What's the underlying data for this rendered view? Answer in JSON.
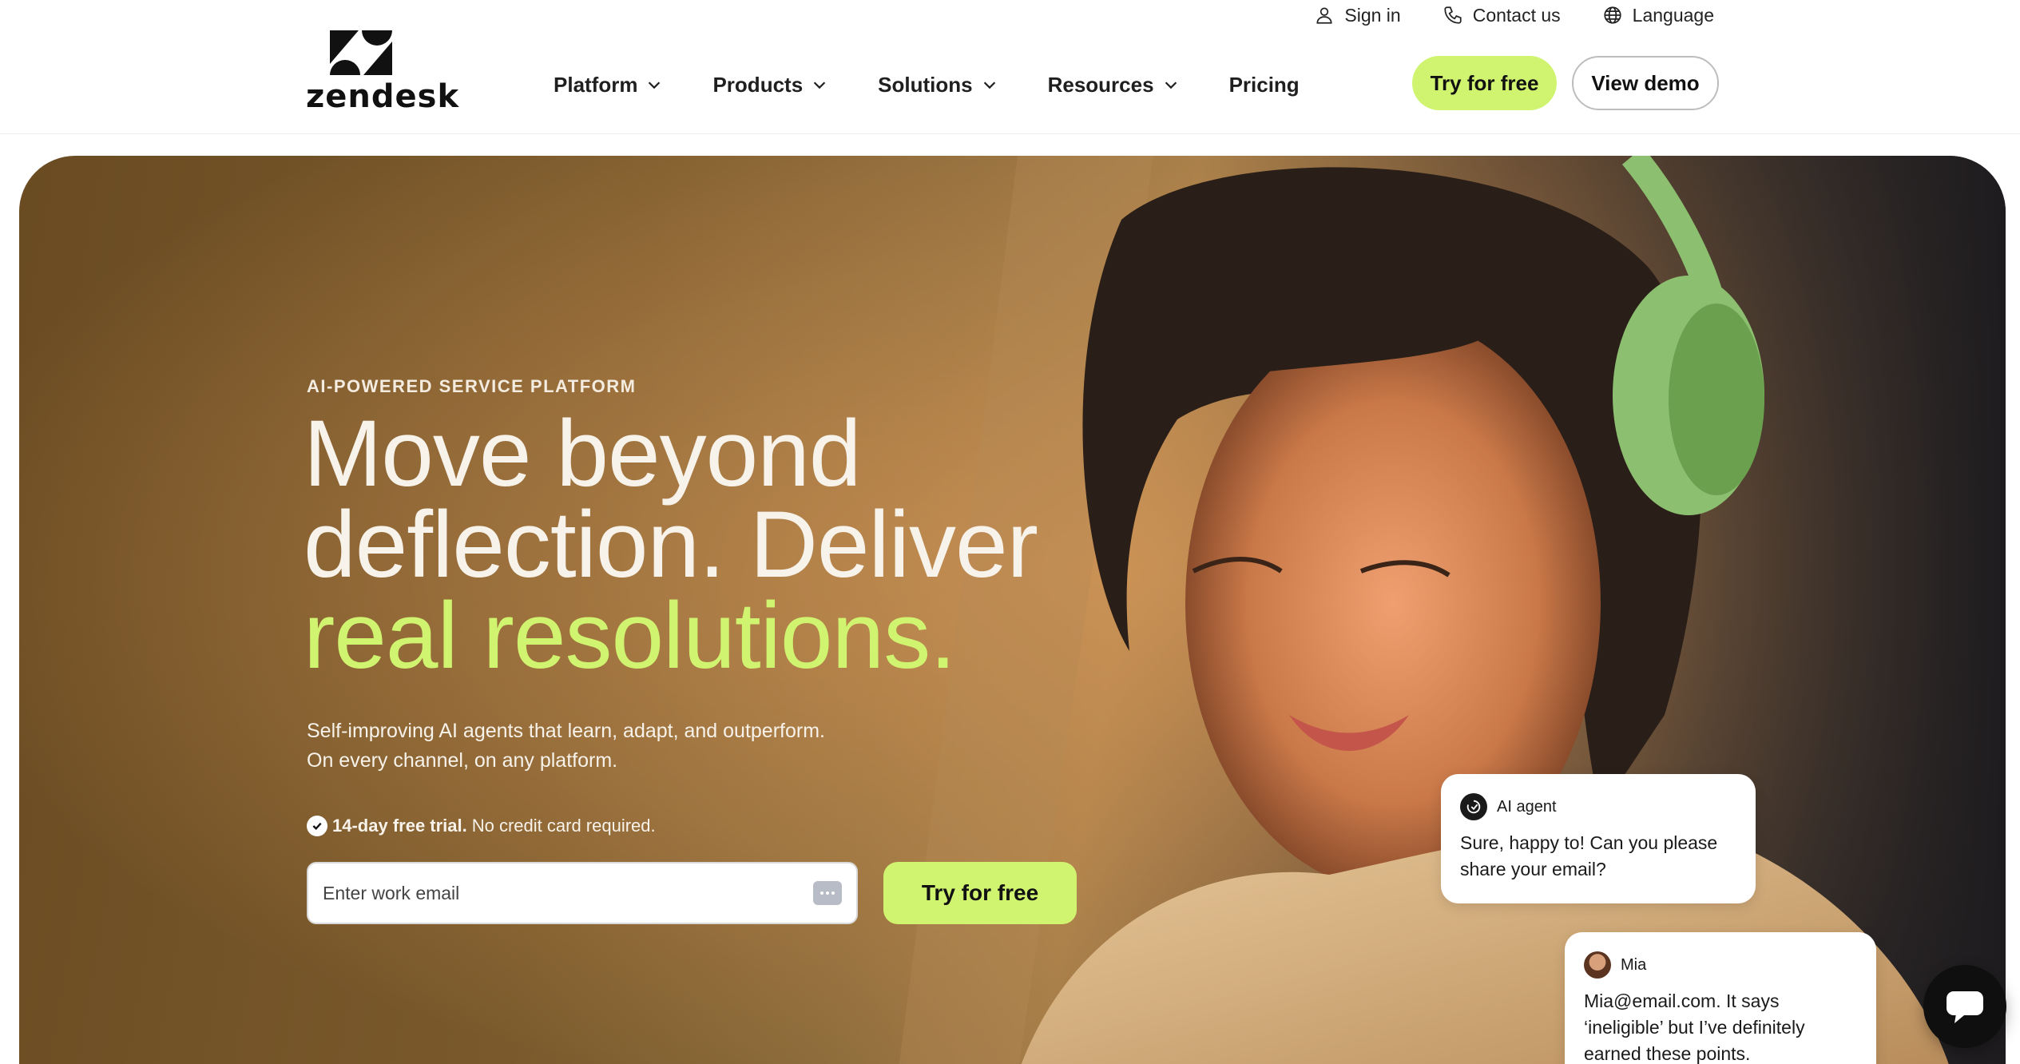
{
  "brand": {
    "name": "zendesk",
    "accent": "#d1f470"
  },
  "utility_nav": [
    {
      "label": "Sign in",
      "icon": "user-icon"
    },
    {
      "label": "Contact us",
      "icon": "phone-icon"
    },
    {
      "label": "Language",
      "icon": "globe-icon"
    }
  ],
  "main_nav": [
    {
      "label": "Platform",
      "has_dropdown": true
    },
    {
      "label": "Products",
      "has_dropdown": true
    },
    {
      "label": "Solutions",
      "has_dropdown": true
    },
    {
      "label": "Resources",
      "has_dropdown": true
    },
    {
      "label": "Pricing",
      "has_dropdown": false
    }
  ],
  "header_buttons": {
    "try_label": "Try for free",
    "demo_label": "View demo"
  },
  "hero": {
    "eyebrow": "AI-POWERED SERVICE PLATFORM",
    "headline_line1": "Move beyond",
    "headline_line2": "deflection. Deliver",
    "headline_accent": "real resolutions.",
    "sub_line1": "Self-improving AI agents that learn, adapt, and outperform.",
    "sub_line2": "On every channel, on any platform.",
    "trial_bold": "14-day free trial.",
    "trial_rest": "No credit card required.",
    "email_placeholder": "Enter work email",
    "cta_label": "Try for free"
  },
  "chat": {
    "ai_name": "AI agent",
    "ai_message": "Sure, happy to! Can you please share your email?",
    "user_name": "Mia",
    "user_message": "Mia@email.com. It says ‘ineligible’ but I’ve definitely earned these points."
  }
}
